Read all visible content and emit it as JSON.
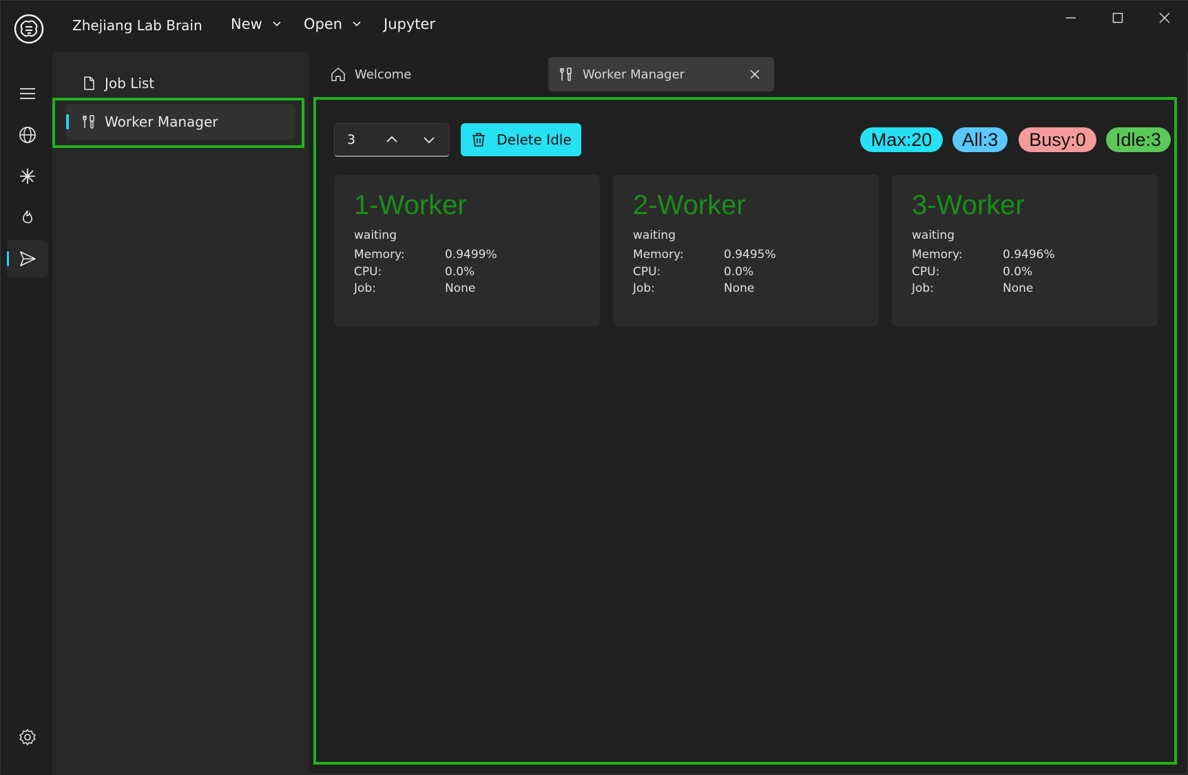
{
  "app": {
    "title": "Zhejiang Lab Brain",
    "logo_icon": "brain-icon"
  },
  "menu": [
    {
      "label": "New",
      "has_dropdown": true
    },
    {
      "label": "Open",
      "has_dropdown": true
    },
    {
      "label": "Jupyter",
      "has_dropdown": false
    }
  ],
  "rail": {
    "items": [
      "menu-icon",
      "globe-icon",
      "asterisk-icon",
      "fire-icon",
      "send-icon"
    ],
    "active": "send-icon",
    "bottom": "gear-icon"
  },
  "sidebar": {
    "items": [
      {
        "label": "Job List",
        "icon": "document-icon",
        "active": false
      },
      {
        "label": "Worker Manager",
        "icon": "tools-icon",
        "active": true
      }
    ]
  },
  "tabs": [
    {
      "label": "Welcome",
      "icon": "home-icon",
      "active": false
    },
    {
      "label": "Worker Manager",
      "icon": "tools-icon",
      "active": true,
      "closable": true
    }
  ],
  "toolbar": {
    "worker_count": "3",
    "delete_label": "Delete Idle"
  },
  "stats": {
    "max": "Max:20",
    "all": "All:3",
    "busy": "Busy:0",
    "idle": "Idle:3"
  },
  "colors": {
    "accent": "#26e0f4",
    "max_badge": "#26e0f4",
    "all_badge": "#5ac8fa",
    "busy_badge": "#f59a9a",
    "idle_badge": "#5cc85a",
    "worker_title": "#1a8f1a",
    "highlight": "#22b01c"
  },
  "labels": {
    "memory": "Memory:",
    "cpu": "CPU:",
    "job": "Job:"
  },
  "workers": [
    {
      "title": "1-Worker",
      "status": "waiting",
      "memory": "0.9499%",
      "cpu": "0.0%",
      "job": "None"
    },
    {
      "title": "2-Worker",
      "status": "waiting",
      "memory": "0.9495%",
      "cpu": "0.0%",
      "job": "None"
    },
    {
      "title": "3-Worker",
      "status": "waiting",
      "memory": "0.9496%",
      "cpu": "0.0%",
      "job": "None"
    }
  ]
}
